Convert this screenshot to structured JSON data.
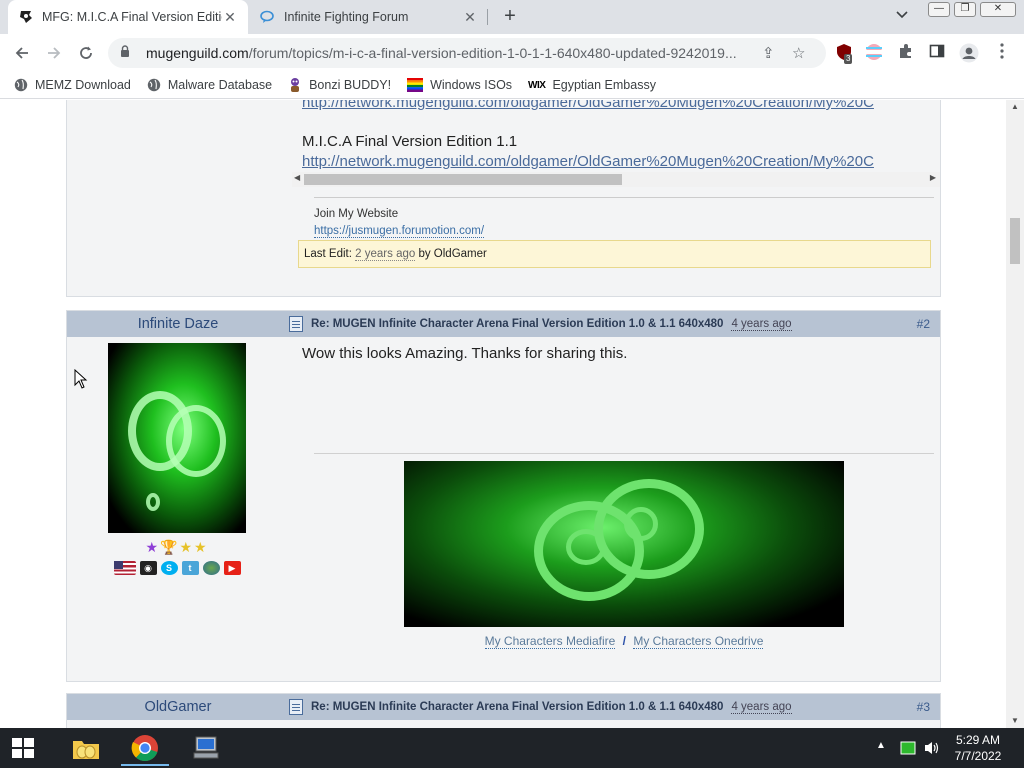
{
  "browser": {
    "tabs": [
      {
        "title": "MFG: M.I.C.A Final Version Editio",
        "active": true
      },
      {
        "title": "Infinite Fighting Forum",
        "active": false
      }
    ],
    "new_tab": "+",
    "url_host": "mugenguild.com",
    "url_path": "/forum/topics/m-i-c-a-final-version-edition-1-0-1-1-640x480-updated-9242019...",
    "extension_badge": "3",
    "bookmarks": [
      {
        "label": "MEMZ Download",
        "icon": "globe-icon"
      },
      {
        "label": "Malware Database",
        "icon": "globe-icon"
      },
      {
        "label": "Bonzi BUDDY!",
        "icon": "bonzi-icon"
      },
      {
        "label": "Windows ISOs",
        "icon": "windows-flag-icon"
      },
      {
        "label": "Egyptian Embassy",
        "icon": "wix-icon"
      }
    ]
  },
  "post1": {
    "top_link": "http://network.mugenguild.com/oldgamer/OldGamer%20Mugen%20Creation/My%20C",
    "edition_title": "M.I.C.A Final Version Edition 1.1",
    "edition_link": "http://network.mugenguild.com/oldgamer/OldGamer%20Mugen%20Creation/My%20C",
    "sig_heading": "Join My Website",
    "sig_link": "https://jusmugen.forumotion.com/",
    "last_edit_label": "Last Edit:",
    "last_edit_ago": "2 years ago",
    "last_edit_by": "by OldGamer"
  },
  "post2": {
    "author": "Infinite Daze",
    "subject": "Re: MUGEN Infinite Character Arena Final Version Edition 1.0 & 1.1 640x480",
    "ago": "4 years ago",
    "number": "#2",
    "message": "Wow this looks Amazing. Thanks for sharing this.",
    "sig_link_1": "My Characters Mediafire",
    "sig_separator": "/",
    "sig_link_2": "My Characters Onedrive"
  },
  "post3": {
    "author": "OldGamer",
    "subject": "Re: MUGEN Infinite Character Arena Final Version Edition 1.0 & 1.1 640x480",
    "ago": "4 years ago",
    "number": "#3"
  },
  "taskbar": {
    "time": "5:29 AM",
    "date": "7/7/2022"
  },
  "colors": {
    "post_header": "#b7c3d3",
    "post_bg": "#f3f4f5",
    "last_edit_bg": "#fdf6d7",
    "taskbar": "#1f2328"
  }
}
